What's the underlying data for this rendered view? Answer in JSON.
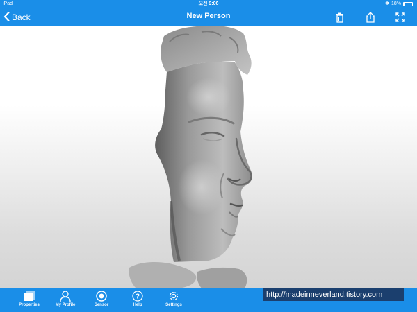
{
  "status_bar": {
    "device": "iPad",
    "time": "오전 9:06",
    "battery_text": "18%",
    "battery_level": 0.18
  },
  "nav": {
    "back_label": "Back",
    "title": "New Person",
    "icons": [
      "trash-icon",
      "share-icon",
      "fullscreen-icon"
    ]
  },
  "viewer": {
    "content": "3d-face-scan-model"
  },
  "tabs": [
    {
      "label": "Properties",
      "icon": "properties-icon"
    },
    {
      "label": "My Profile",
      "icon": "profile-icon"
    },
    {
      "label": "Sensor",
      "icon": "sensor-icon"
    },
    {
      "label": "Help",
      "icon": "help-icon"
    },
    {
      "label": "Settings",
      "icon": "settings-icon"
    }
  ],
  "watermark": "http://madeinneverland.tistory.com",
  "colors": {
    "accent": "#1a8ee8",
    "watermark_bg": "#1b3f6e"
  }
}
